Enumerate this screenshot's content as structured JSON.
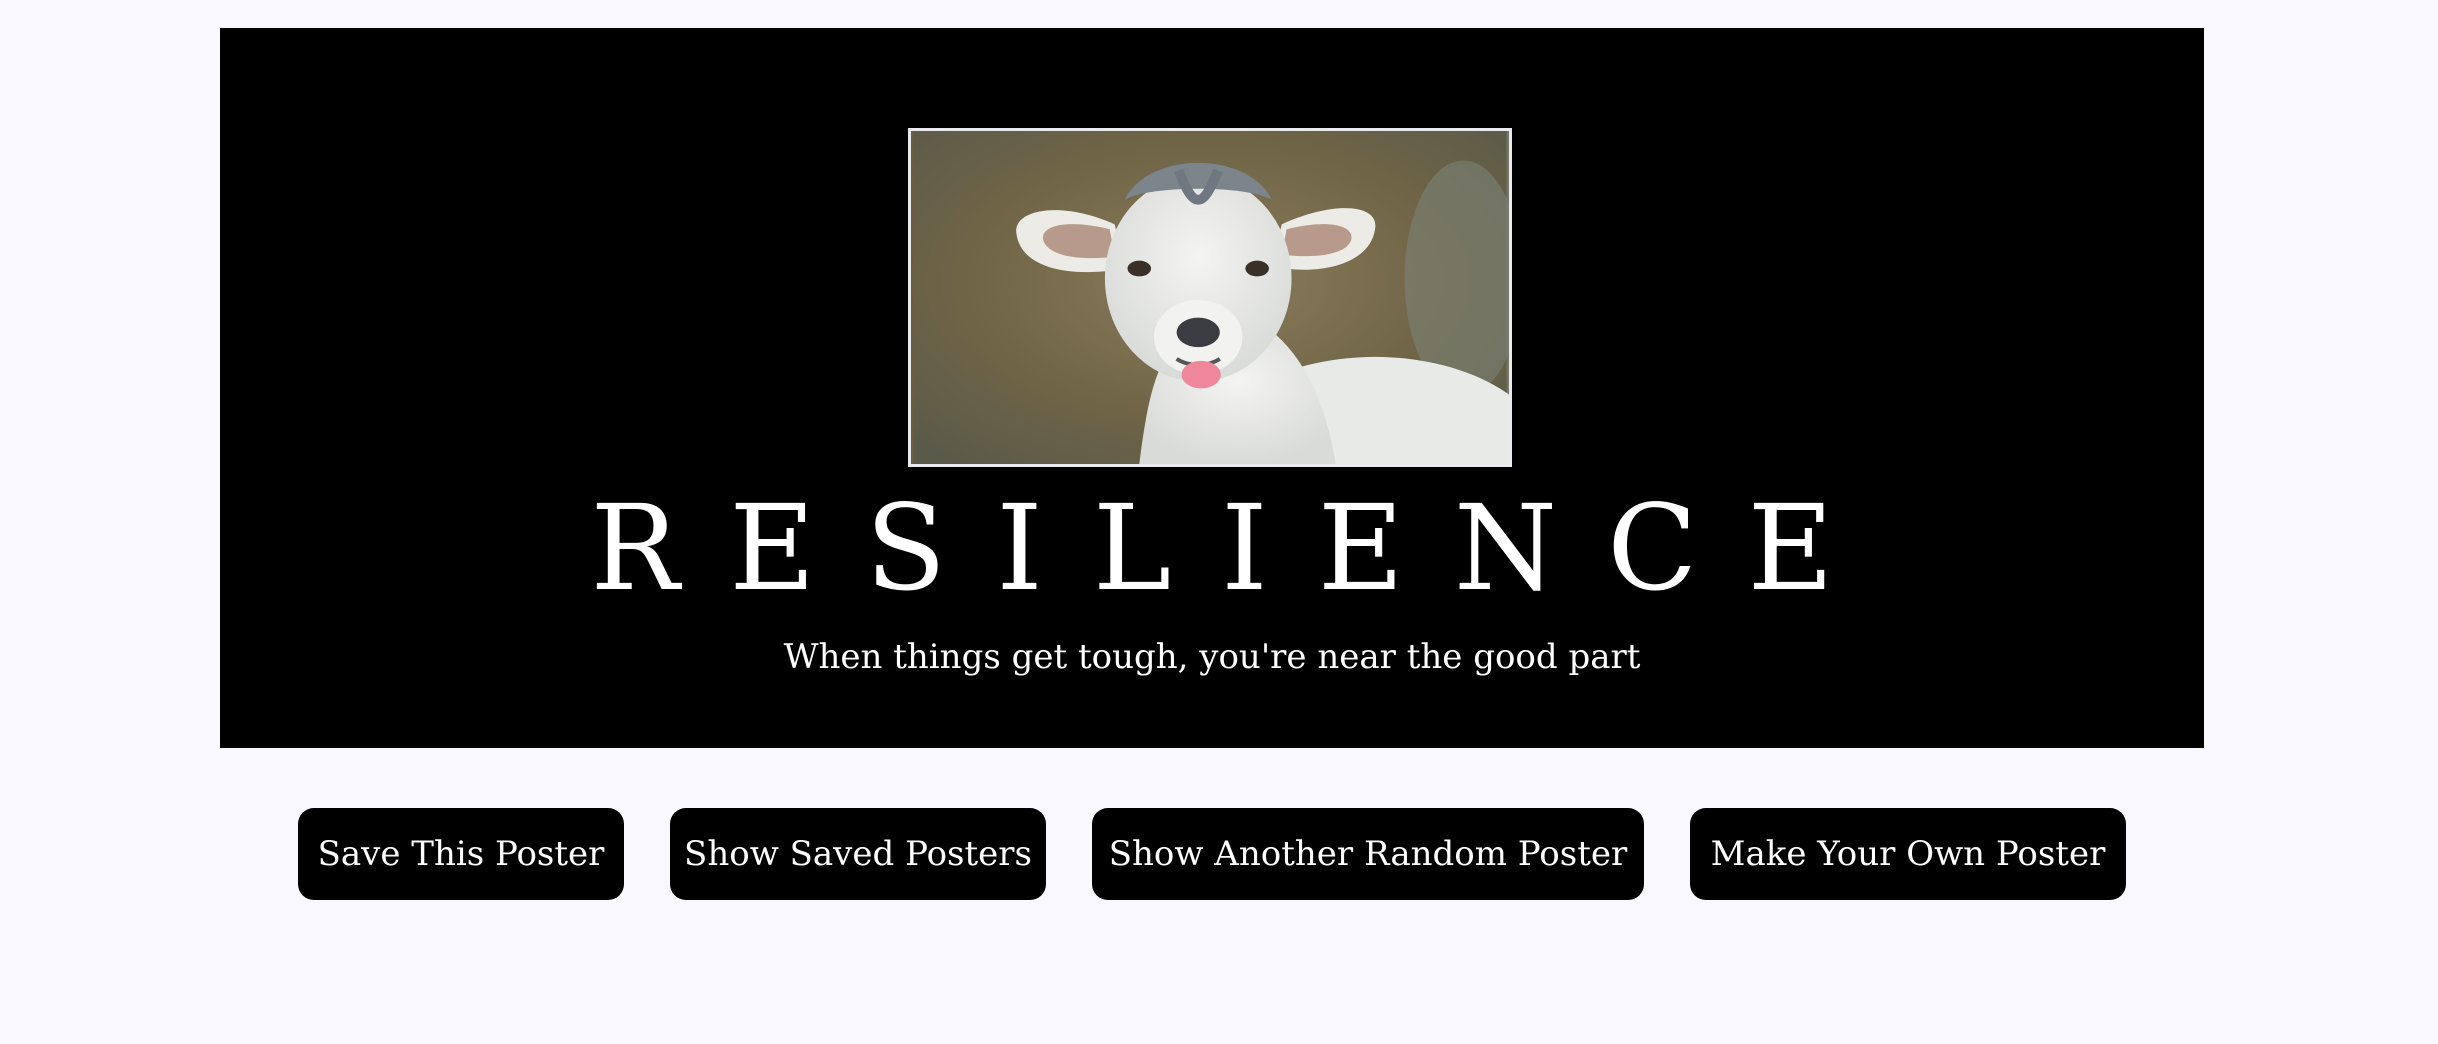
{
  "poster": {
    "image_alt": "smiling baby goat sticking out its tongue",
    "title": "RESILIENCE",
    "quote": "When things get tough, you're near the good part"
  },
  "buttons": {
    "save": "Save This Poster",
    "show_saved": "Show Saved Posters",
    "random": "Show Another Random Poster",
    "make_own": "Make Your Own Poster"
  },
  "colors": {
    "page_background": "#f8f8fe",
    "poster_background": "#000000",
    "button_background": "#000000",
    "text_on_dark": "#ffffff"
  }
}
